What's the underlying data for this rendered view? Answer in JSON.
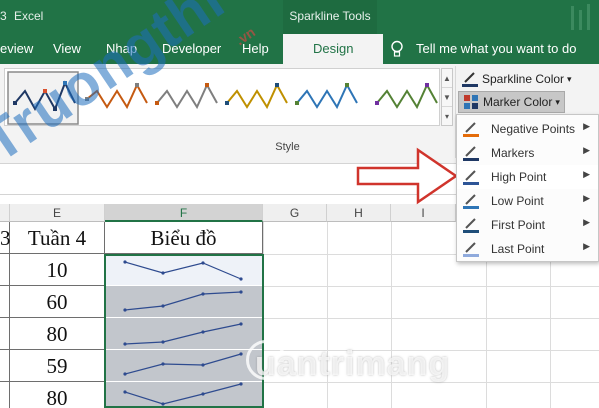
{
  "titlebar": {
    "left_partial": "3",
    "app": "Excel",
    "context_title": "Sparkline Tools"
  },
  "tabs": {
    "review": "eview",
    "view": "View",
    "nhap": "Nhap",
    "developer": "Developer",
    "help": "Help",
    "design": "Design",
    "tell_me": "Tell me what you want to do"
  },
  "ribbon": {
    "group_label": "Style",
    "sparkline_color": "Sparkline Color",
    "marker_color": "Marker Color",
    "dropdown_arrow": "▾"
  },
  "menu": {
    "items": [
      {
        "label": "Negative Points",
        "icon_color": "#e46c0a"
      },
      {
        "label": "Markers",
        "icon_color": "#1f3864"
      },
      {
        "label": "High Point",
        "icon_color": "#2e5597"
      },
      {
        "label": "Low Point",
        "icon_color": "#2e75b6"
      },
      {
        "label": "First Point",
        "icon_color": "#1f4e79"
      },
      {
        "label": "Last Point",
        "icon_color": "#8faadc"
      }
    ],
    "arrow": "▶"
  },
  "sheet": {
    "columns": [
      {
        "label": "",
        "w": 0
      },
      {
        "label": "E"
      },
      {
        "label": "F"
      },
      {
        "label": "G"
      },
      {
        "label": "H"
      },
      {
        "label": "I"
      }
    ],
    "header_row": {
      "partial_d": "3",
      "tuan4": "Tuần 4",
      "bieudo": "Biểu đồ"
    },
    "values": [
      "10",
      "60",
      "80",
      "59",
      "80"
    ]
  },
  "watermark": {
    "left": "Truongthi",
    "left_sub": ".vn",
    "right": "uantrimang"
  },
  "colors": {
    "excel_green": "#217346",
    "sparkline_blue": "#2e4b8f",
    "highlight_gray": "#c2c6cc"
  }
}
